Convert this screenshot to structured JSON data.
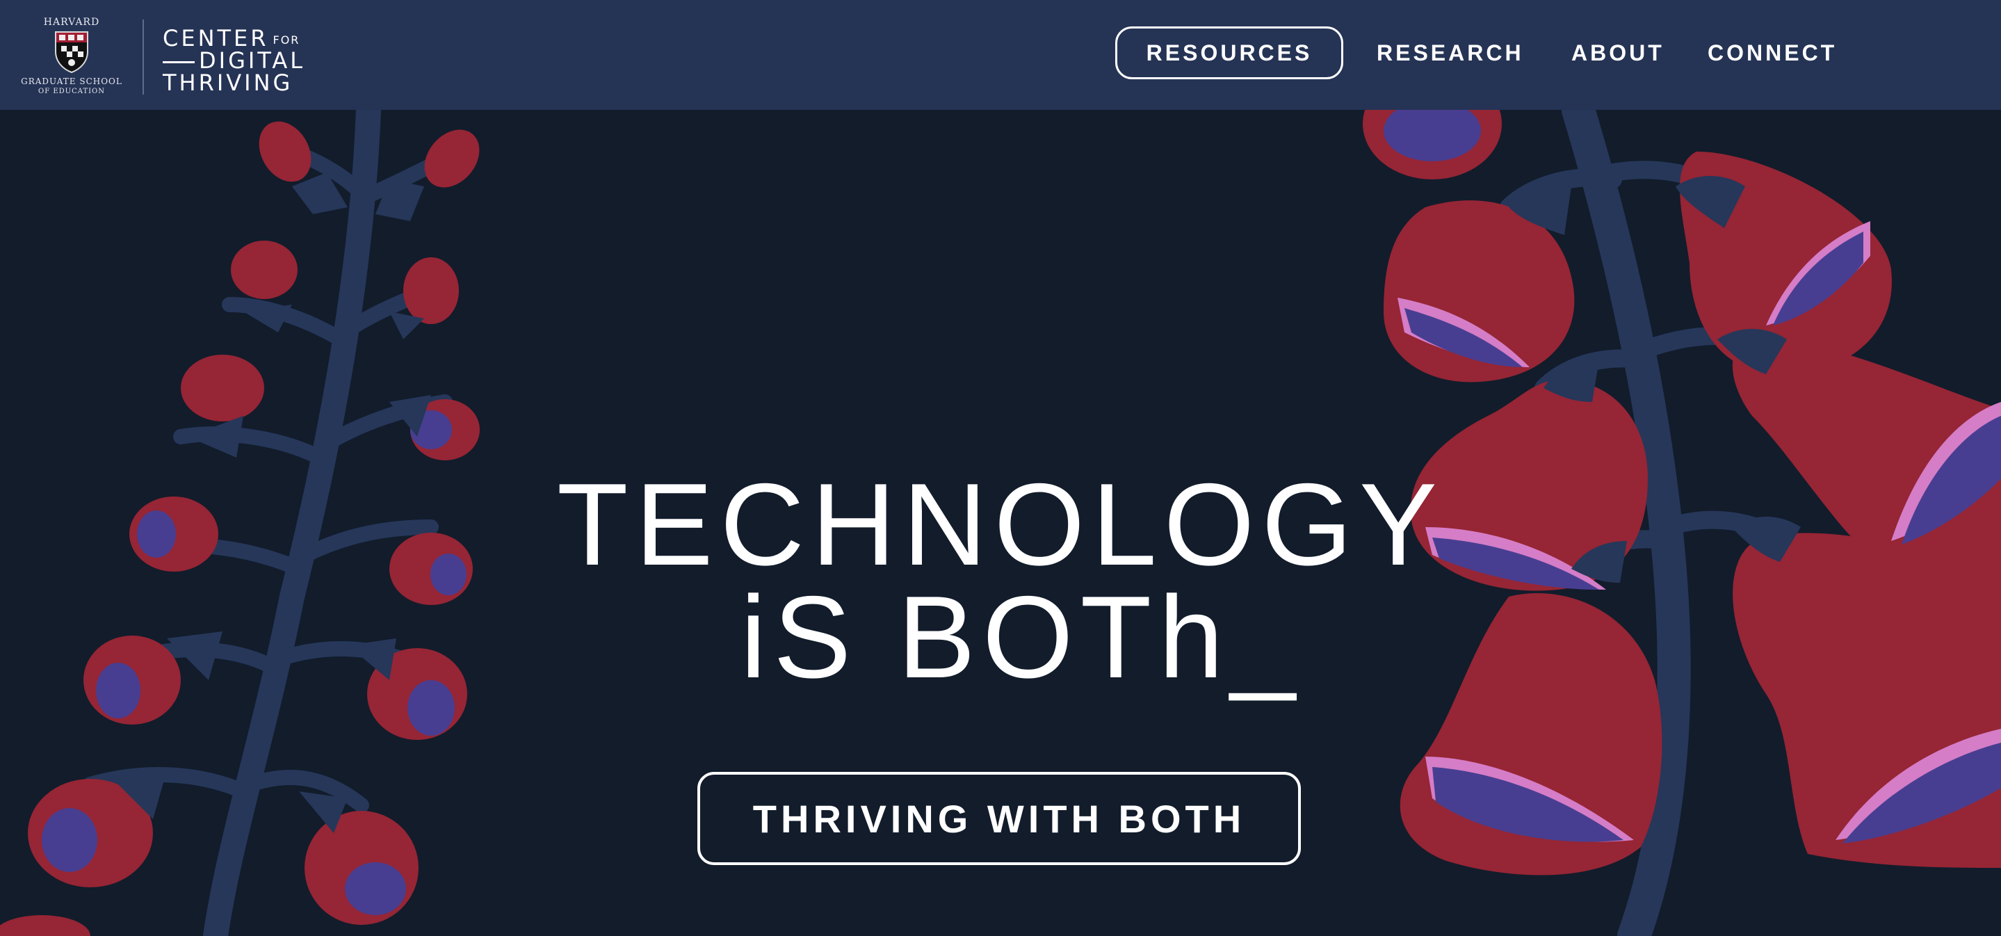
{
  "header": {
    "harvard_logo": {
      "top_text": "HARVARD",
      "bottom_line1": "GRADUATE SCHOOL",
      "bottom_line2": "OF EDUCATION"
    },
    "center_logo": {
      "line1": "CENTER",
      "line1_small": "FOR",
      "line2": "DIGITAL",
      "line3": "THRIVING"
    },
    "nav": [
      {
        "label": "RESOURCES"
      },
      {
        "label": "RESEARCH"
      },
      {
        "label": "ABOUT"
      },
      {
        "label": "CONNECT"
      }
    ]
  },
  "hero": {
    "title_line1": "TECHNOLOGY",
    "title_line2": "iS BOTh_",
    "cta_label": "THRIVING WITH BOTH"
  },
  "colors": {
    "header_bg": "#253355",
    "page_bg": "#121c2b",
    "stem": "#26375a",
    "flower_red": "#962535",
    "flower_purple": "#483e91",
    "flower_pink": "#d57dc7"
  },
  "icons": [
    "harvard-shield-icon",
    "foxglove-illustration"
  ]
}
